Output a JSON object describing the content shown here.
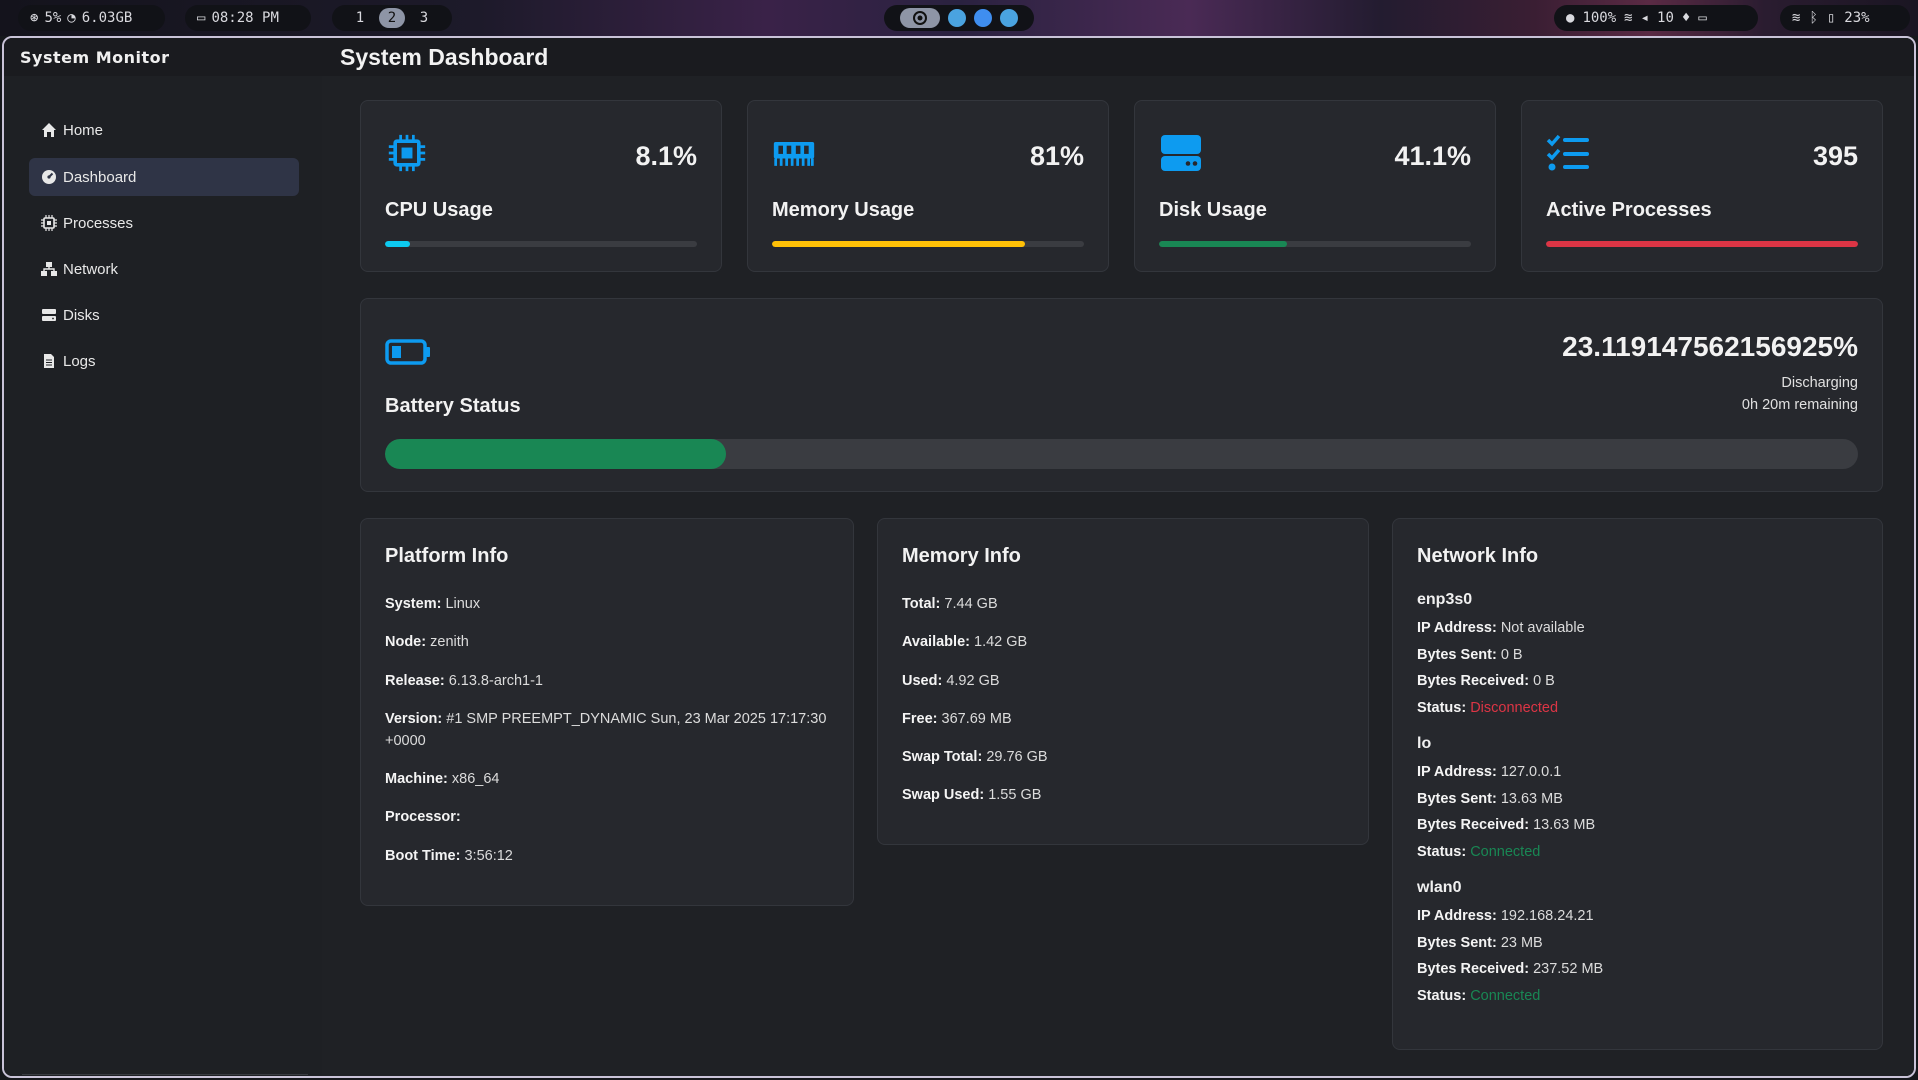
{
  "topbar": {
    "cpu": "5%",
    "memory": "6.03GB",
    "clock": "08:28 PM",
    "workspaces": [
      "1",
      "2",
      "3"
    ],
    "active_workspace": "2",
    "brightness": "100%",
    "volume": "10",
    "battery": "23%"
  },
  "window": {
    "app_title": "System Monitor",
    "page_title": "System Dashboard"
  },
  "sidebar": {
    "items": [
      {
        "label": "Home",
        "icon": "home-icon"
      },
      {
        "label": "Dashboard",
        "icon": "dashboard-icon",
        "active": true
      },
      {
        "label": "Processes",
        "icon": "processes-icon"
      },
      {
        "label": "Network",
        "icon": "network-icon"
      },
      {
        "label": "Disks",
        "icon": "disks-icon"
      },
      {
        "label": "Logs",
        "icon": "logs-icon"
      }
    ]
  },
  "stats": {
    "cpu": {
      "label": "CPU Usage",
      "value": "8.1%",
      "percent": 8.1,
      "color": "#0dcaf0"
    },
    "memory": {
      "label": "Memory Usage",
      "value": "81%",
      "percent": 81,
      "color": "#ffc107"
    },
    "disk": {
      "label": "Disk Usage",
      "value": "41.1%",
      "percent": 41.1,
      "color": "#198754"
    },
    "processes": {
      "label": "Active Processes",
      "value": "395",
      "percent": 100,
      "color": "#dc3545"
    }
  },
  "battery": {
    "label": "Battery Status",
    "value": "23.119147562156925%",
    "percent": 23.119147562156925,
    "state": "Discharging",
    "remaining": "0h 20m remaining",
    "color": "#198754"
  },
  "platform": {
    "title": "Platform Info",
    "rows": [
      {
        "key": "System:",
        "value": "Linux"
      },
      {
        "key": "Node:",
        "value": "zenith"
      },
      {
        "key": "Release:",
        "value": "6.13.8-arch1-1"
      },
      {
        "key": "Version:",
        "value": "#1 SMP PREEMPT_DYNAMIC Sun, 23 Mar 2025 17:17:30 +0000"
      },
      {
        "key": "Machine:",
        "value": "x86_64"
      },
      {
        "key": "Processor:",
        "value": ""
      },
      {
        "key": "Boot Time:",
        "value": "3:56:12"
      }
    ]
  },
  "memory_info": {
    "title": "Memory Info",
    "rows": [
      {
        "key": "Total:",
        "value": "7.44 GB"
      },
      {
        "key": "Available:",
        "value": "1.42 GB"
      },
      {
        "key": "Used:",
        "value": "4.92 GB"
      },
      {
        "key": "Free:",
        "value": "367.69 MB"
      },
      {
        "key": "Swap Total:",
        "value": "29.76 GB"
      },
      {
        "key": "Swap Used:",
        "value": "1.55 GB"
      }
    ]
  },
  "network_info": {
    "title": "Network Info",
    "labels": {
      "ip": "IP Address:",
      "sent": "Bytes Sent:",
      "recv": "Bytes Received:",
      "status": "Status:"
    },
    "interfaces": [
      {
        "name": "enp3s0",
        "ip": "Not available",
        "sent": "0 B",
        "recv": "0 B",
        "status": "Disconnected",
        "status_color": "#dc3545"
      },
      {
        "name": "lo",
        "ip": "127.0.0.1",
        "sent": "13.63 MB",
        "recv": "13.63 MB",
        "status": "Connected",
        "status_color": "#198754"
      },
      {
        "name": "wlan0",
        "ip": "192.168.24.21",
        "sent": "23 MB",
        "recv": "237.52 MB",
        "status": "Connected",
        "status_color": "#198754"
      }
    ]
  }
}
